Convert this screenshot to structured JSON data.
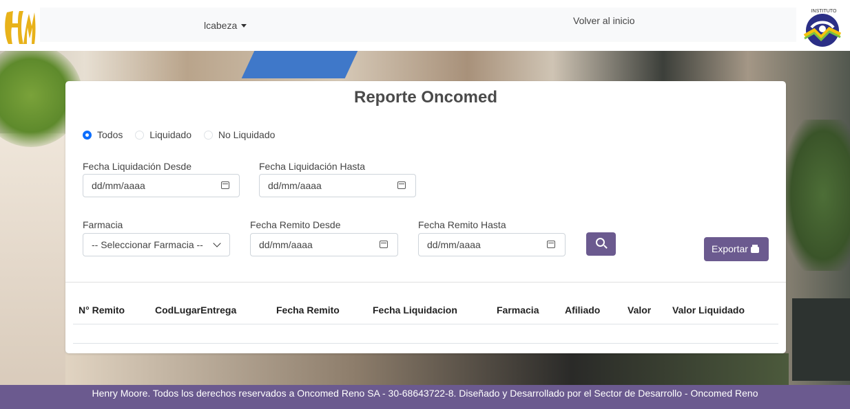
{
  "header": {
    "user_name": "lcabeza",
    "home_link": "Volver al inicio",
    "logo_left_text": "HM",
    "logo_right_text": "INSTITUTO"
  },
  "report": {
    "title": "Reporte Oncomed",
    "radio_options": [
      {
        "label": "Todos",
        "checked": true
      },
      {
        "label": "Liquidado",
        "checked": false
      },
      {
        "label": "No Liquidado",
        "checked": false
      }
    ],
    "fecha_liq_desde": {
      "label": "Fecha Liquidación Desde",
      "value": "dd/mm/aaaa"
    },
    "fecha_liq_hasta": {
      "label": "Fecha Liquidación Hasta",
      "value": "dd/mm/aaaa"
    },
    "farmacia": {
      "label": "Farmacia",
      "value": "-- Seleccionar Farmacia --"
    },
    "fecha_remito_desde": {
      "label": "Fecha Remito Desde",
      "value": "dd/mm/aaaa"
    },
    "fecha_remito_hasta": {
      "label": "Fecha Remito Hasta",
      "value": "dd/mm/aaaa"
    },
    "export_label": "Exportar",
    "columns": [
      "N° Remito",
      "CodLugarEntrega",
      "Fecha Remito",
      "Fecha Liquidacion",
      "Farmacia",
      "Afiliado",
      "Valor",
      "Valor Liquidado"
    ],
    "rows": []
  },
  "footer": {
    "text": "Henry Moore. Todos los derechos reservados a Oncomed Reno SA - 30-68643722-8. Diseñado y Desarrollado por el Sector de Desarrollo - Oncomed Reno"
  },
  "colors": {
    "accent": "#6b5a8f",
    "radio_checked": "#0d6efd",
    "logo_gold": "#e8b21a",
    "logo_navy": "#2b2f86"
  },
  "icons": [
    "calendar-icon",
    "chevron-down-icon",
    "search-icon",
    "printer-icon",
    "caret-down-icon"
  ]
}
